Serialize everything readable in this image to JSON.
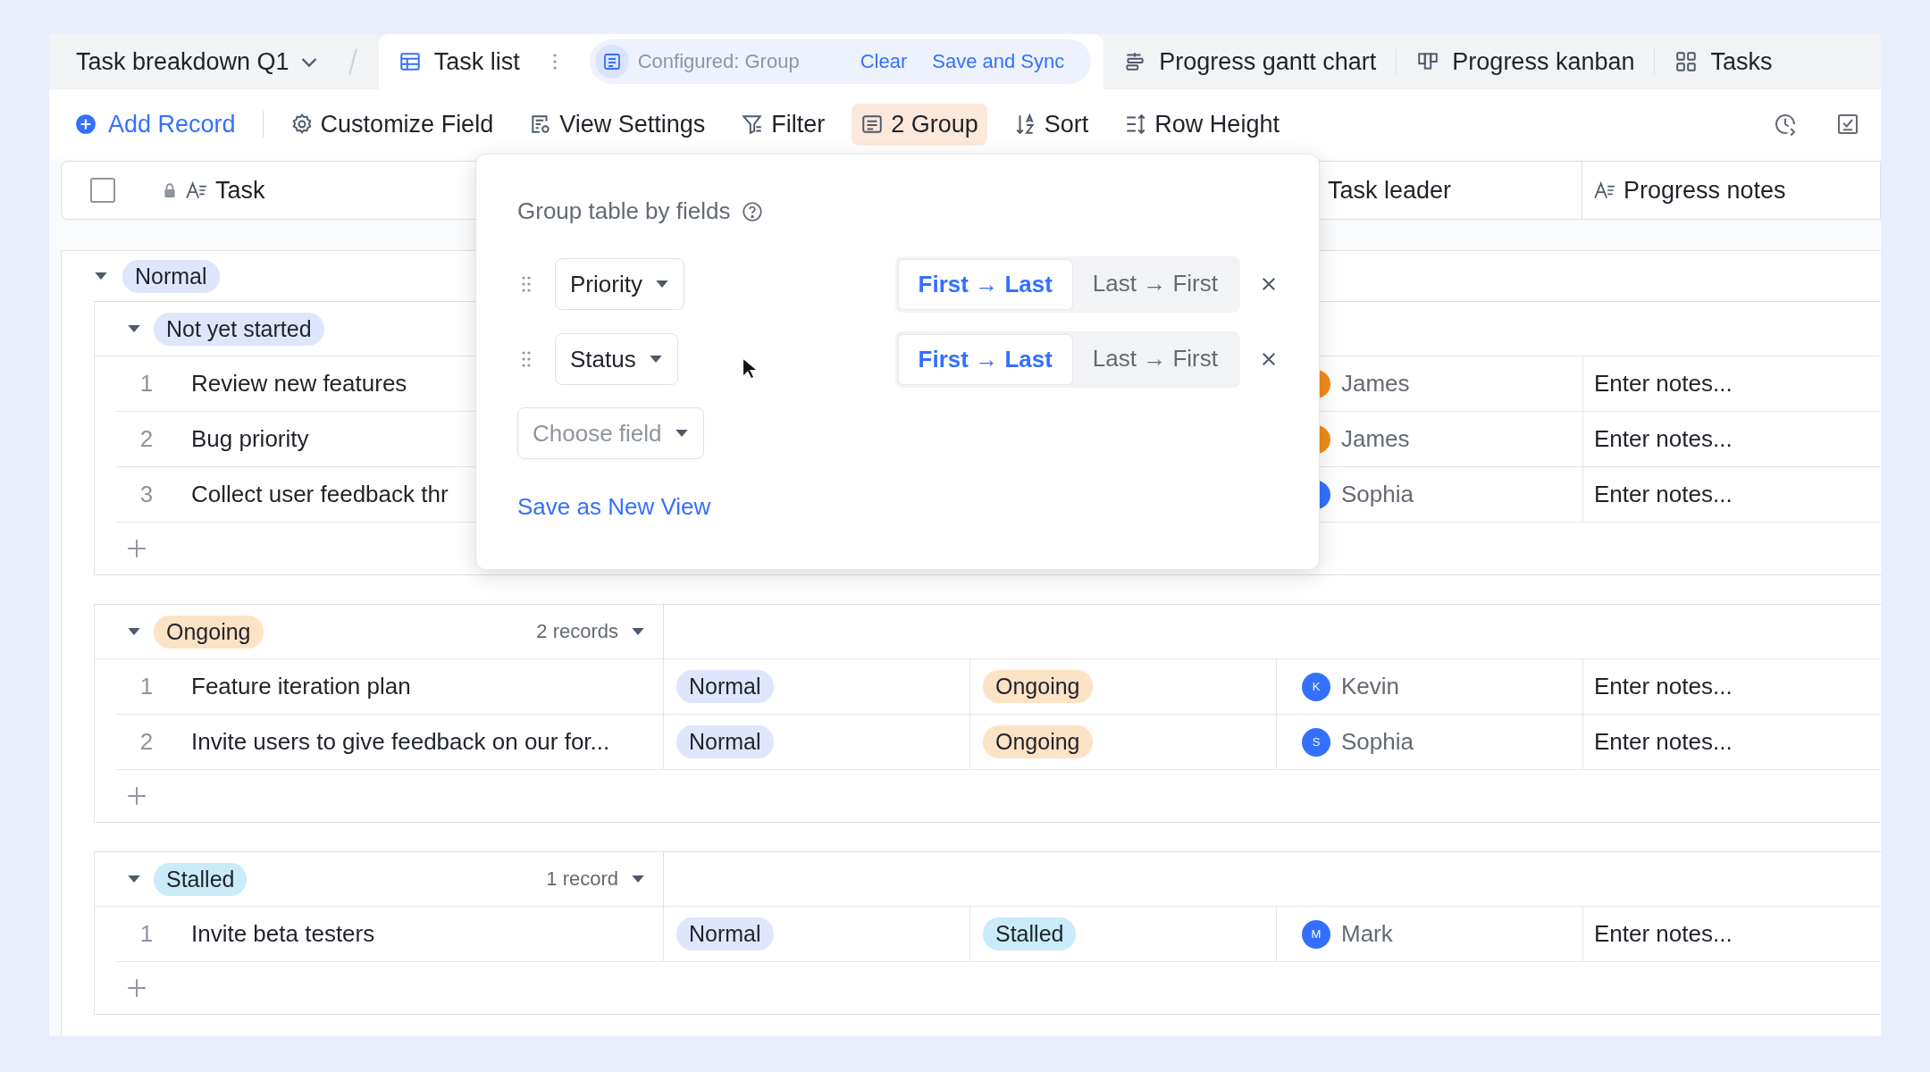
{
  "header": {
    "title": "Task breakdown Q1",
    "tabs": [
      {
        "label": "Task list",
        "kind": "table",
        "selected": true
      },
      {
        "label": "Progress gantt chart",
        "kind": "gantt",
        "selected": false
      },
      {
        "label": "Progress kanban",
        "kind": "kanban",
        "selected": false
      },
      {
        "label": "Tasks",
        "kind": "tiles",
        "selected": false
      }
    ],
    "config": {
      "status": "Configured: Group",
      "clear": "Clear",
      "save": "Save and Sync"
    }
  },
  "toolbar": {
    "add": "Add Record",
    "tools": [
      {
        "label": "Customize Field",
        "kind": "gear",
        "selected": false
      },
      {
        "label": "View Settings",
        "kind": "view",
        "selected": false
      },
      {
        "label": "Filter",
        "kind": "filter",
        "selected": false
      },
      {
        "label": "2 Group",
        "kind": "group",
        "selected": true
      },
      {
        "label": "Sort",
        "kind": "sort",
        "selected": false
      },
      {
        "label": "Row Height",
        "kind": "height",
        "selected": false
      }
    ]
  },
  "select_all": {
    "checked": false
  },
  "columns": {
    "task": "Task",
    "task_leader": "Task leader",
    "progress_notes": "Progress notes"
  },
  "groups": [
    {
      "label": "Normal",
      "color": "#dfe6fb",
      "expanded": true,
      "children": [
        {
          "label": "Not yet started",
          "color": "#dfe6fb",
          "expanded": true,
          "rows": [
            {
              "index": "1",
              "task": "Review new features",
              "leader": "James",
              "color": "#f08c1a",
              "notes": "Enter notes..."
            },
            {
              "index": "2",
              "task": "Bug priority",
              "leader": "James",
              "color": "#f08c1a",
              "notes": "Enter notes..."
            },
            {
              "index": "3",
              "task": "Collect user feedback thr",
              "leader": "Sophia",
              "color": "#3370ff",
              "notes": "Enter notes..."
            }
          ]
        },
        {
          "label": "Ongoing",
          "color": "#fde3c6",
          "expanded": true,
          "count": "2 records",
          "rows": [
            {
              "index": "1",
              "task": "Feature iteration plan",
              "priority": {
                "label": "Normal",
                "color": "#dfe6fb"
              },
              "status": {
                "label": "Ongoing",
                "color": "#fde3c6"
              },
              "leader": "Kevin",
              "initial": "K",
              "color": "#3370ff",
              "notes": "Enter notes..."
            },
            {
              "index": "2",
              "task": "Invite users to give feedback on our for...",
              "priority": {
                "label": "Normal",
                "color": "#dfe6fb"
              },
              "status": {
                "label": "Ongoing",
                "color": "#fde3c6"
              },
              "leader": "Sophia",
              "initial": "S",
              "color": "#3370ff",
              "notes": "Enter notes..."
            }
          ]
        },
        {
          "label": "Stalled",
          "color": "#c9ecf8",
          "expanded": true,
          "count": "1 record",
          "rows": [
            {
              "index": "1",
              "task": "Invite beta testers",
              "priority": {
                "label": "Normal",
                "color": "#dfe6fb"
              },
              "status": {
                "label": "Stalled",
                "color": "#c9ecf8"
              },
              "leader": "Mark",
              "initial": "M",
              "color": "#3370ff",
              "notes": "Enter notes..."
            }
          ]
        }
      ]
    }
  ],
  "popover": {
    "title": "Group table by fields",
    "rules": [
      {
        "field": "Priority",
        "options": [
          {
            "label": "First → Last",
            "selected": true
          },
          {
            "label": "Last → First",
            "selected": false
          }
        ]
      },
      {
        "field": "Status",
        "options": [
          {
            "label": "First → Last",
            "selected": true
          },
          {
            "label": "Last → First",
            "selected": false
          }
        ]
      }
    ],
    "add_placeholder": "Choose field",
    "save_view": "Save as New View"
  }
}
